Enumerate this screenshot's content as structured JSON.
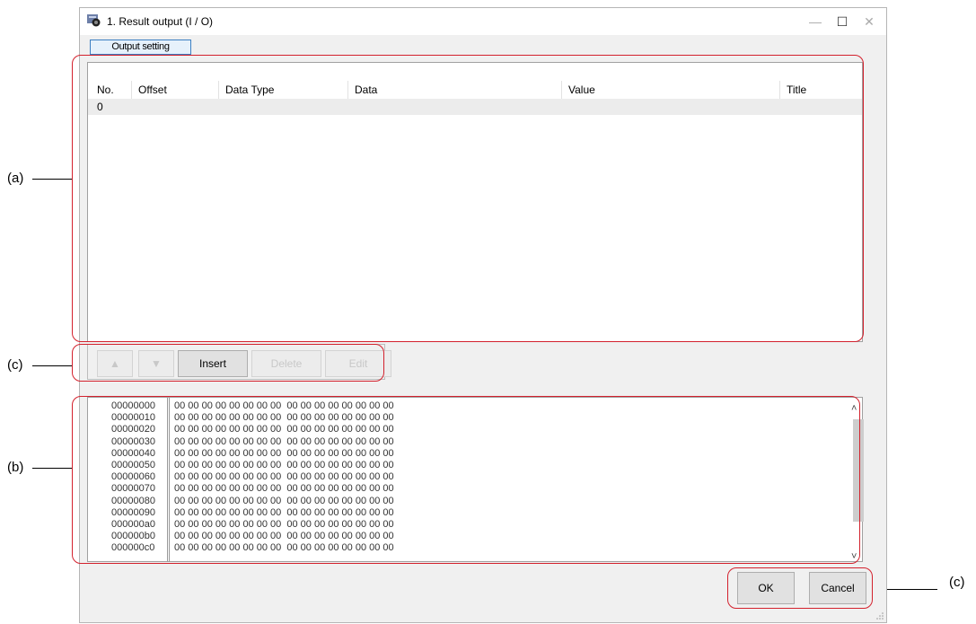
{
  "window": {
    "title": "1. Result output (I / O)",
    "controls": [
      "—",
      "☐",
      "✕"
    ]
  },
  "tabs": [
    {
      "label": "Output setting",
      "active": true
    }
  ],
  "table": {
    "columns": [
      "No.",
      "Offset",
      "Data Type",
      "Data",
      "Value",
      "Title"
    ],
    "rows": [
      [
        "0",
        "",
        "",
        "",
        "",
        ""
      ]
    ]
  },
  "buttons": {
    "up": "▲",
    "down": "▼",
    "insert": "Insert",
    "delete": "Delete",
    "edit": "Edit"
  },
  "hex": {
    "lines": [
      {
        "addr": "00000000",
        "bytes": "00 00 00 00 00 00 00 00  00 00 00 00 00 00 00 00"
      },
      {
        "addr": "00000010",
        "bytes": "00 00 00 00 00 00 00 00  00 00 00 00 00 00 00 00"
      },
      {
        "addr": "00000020",
        "bytes": "00 00 00 00 00 00 00 00  00 00 00 00 00 00 00 00"
      },
      {
        "addr": "00000030",
        "bytes": "00 00 00 00 00 00 00 00  00 00 00 00 00 00 00 00"
      },
      {
        "addr": "00000040",
        "bytes": "00 00 00 00 00 00 00 00  00 00 00 00 00 00 00 00"
      },
      {
        "addr": "00000050",
        "bytes": "00 00 00 00 00 00 00 00  00 00 00 00 00 00 00 00"
      },
      {
        "addr": "00000060",
        "bytes": "00 00 00 00 00 00 00 00  00 00 00 00 00 00 00 00"
      },
      {
        "addr": "00000070",
        "bytes": "00 00 00 00 00 00 00 00  00 00 00 00 00 00 00 00"
      },
      {
        "addr": "00000080",
        "bytes": "00 00 00 00 00 00 00 00  00 00 00 00 00 00 00 00"
      },
      {
        "addr": "00000090",
        "bytes": "00 00 00 00 00 00 00 00  00 00 00 00 00 00 00 00"
      },
      {
        "addr": "000000a0",
        "bytes": "00 00 00 00 00 00 00 00  00 00 00 00 00 00 00 00"
      },
      {
        "addr": "000000b0",
        "bytes": "00 00 00 00 00 00 00 00  00 00 00 00 00 00 00 00"
      },
      {
        "addr": "000000c0",
        "bytes": "00 00 00 00 00 00 00 00  00 00 00 00 00 00 00 00"
      }
    ]
  },
  "dialog_buttons": {
    "ok": "OK",
    "cancel": "Cancel"
  },
  "annotations": {
    "a": "(a)",
    "b": "(b)",
    "c1": "(c)",
    "c2": "(c)"
  },
  "colors": {
    "highlight": "#d3212d",
    "tab_border": "#3c7fc2"
  }
}
